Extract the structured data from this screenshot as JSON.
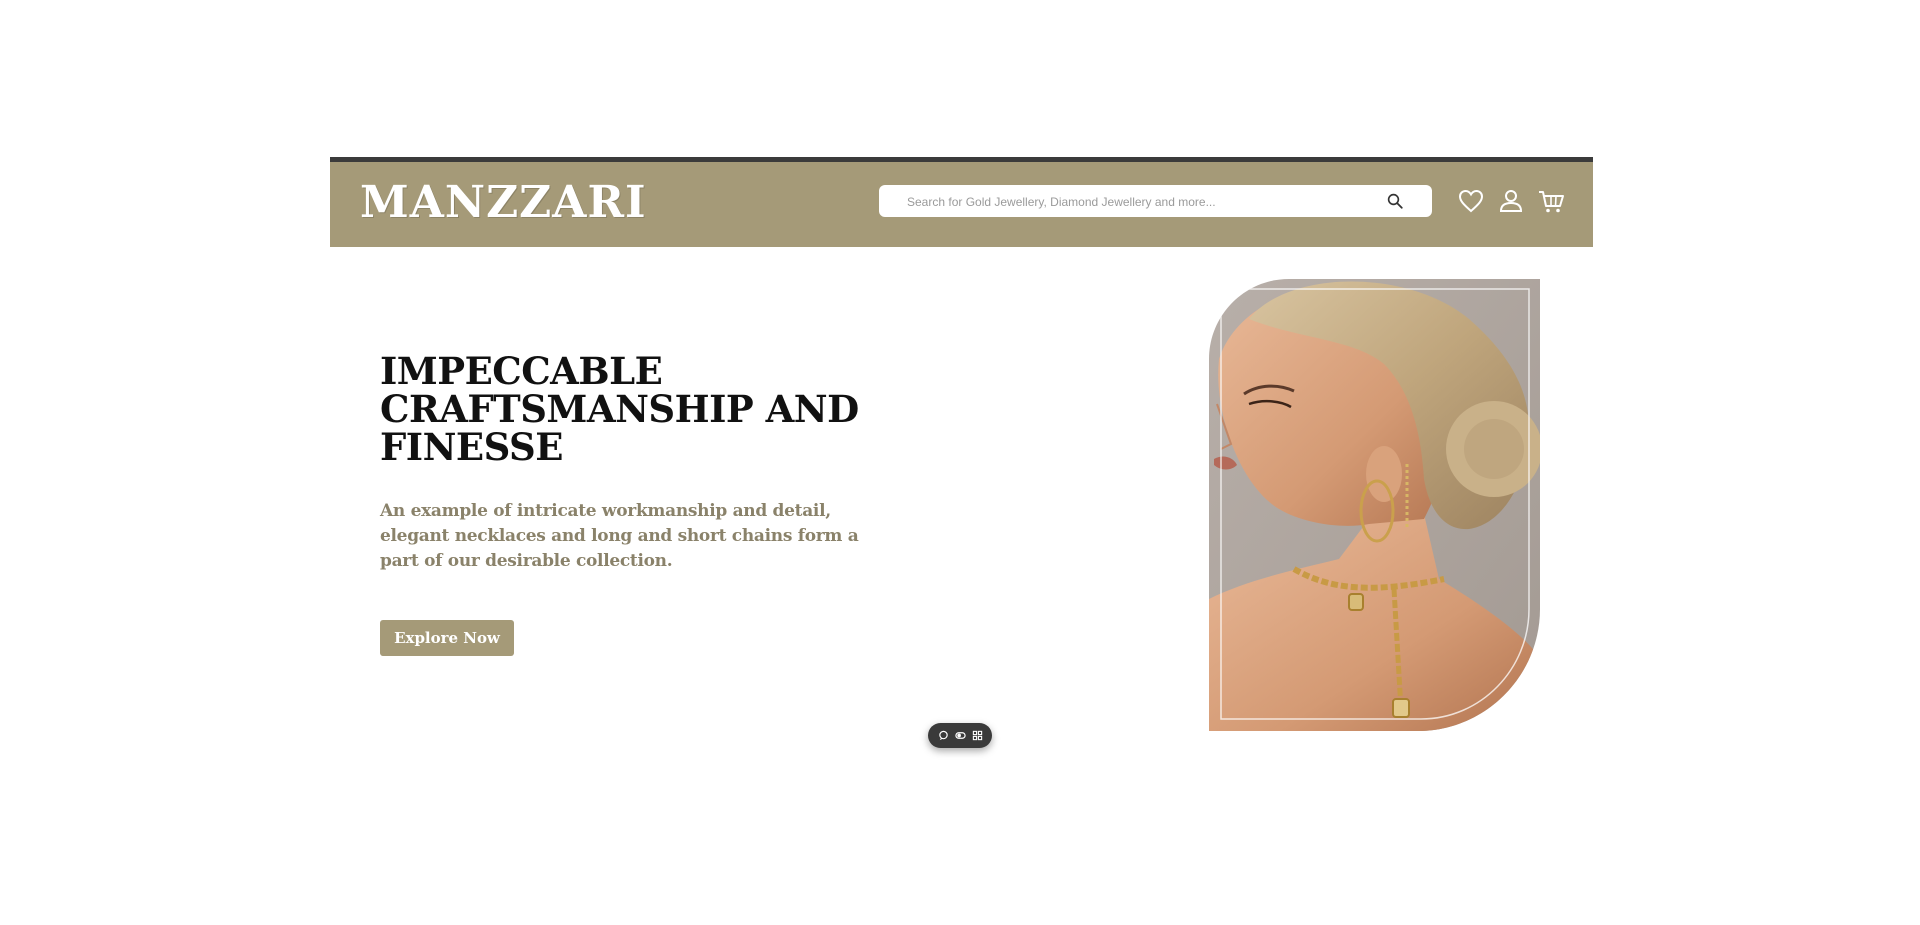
{
  "header": {
    "logo_text": "MANZZARI",
    "background_color": "#a59a78",
    "top_border_color": "#3b3b3b",
    "search": {
      "placeholder": "Search for Gold Jewellery, Diamond Jewellery and more...",
      "value": "",
      "icon": "search-icon"
    },
    "icons": [
      "heart-icon",
      "user-icon",
      "cart-icon"
    ]
  },
  "hero": {
    "title": "IMPECCABLE CRAFTSMANSHIP AND FINESSE",
    "subtitle": "An example of intricate workmanship and detail, elegant necklaces and long and short chains form a part of our desirable collection.",
    "cta_label": "Explore Now",
    "image": "model-with-gold-jewellery",
    "accent_color": "#a59a78",
    "subtitle_color": "#8a826a"
  },
  "floating_toolbar": {
    "icons": [
      "chat-icon",
      "toggle-icon",
      "grid-icon"
    ]
  }
}
